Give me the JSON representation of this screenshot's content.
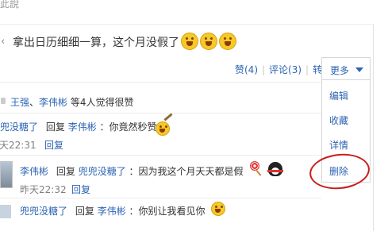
{
  "page": {
    "top_fragment": "此說"
  },
  "post": {
    "caret": "‹",
    "text": "拿出日历细细一算，这个月没假了",
    "emoji_icons": [
      "grinning-face-icon",
      "grinning-face-icon",
      "grinning-face-icon"
    ]
  },
  "actions": {
    "like": "赞(4)",
    "comment": "评论(3)",
    "forward": "转发",
    "more": "更多"
  },
  "more_menu": {
    "items": [
      "编辑",
      "收藏",
      "详情",
      "删除"
    ],
    "highlighted": "删除"
  },
  "likes": {
    "names": [
      "王强",
      "李伟彬"
    ],
    "suffix": "等4人觉得很赞"
  },
  "comments": [
    {
      "author": "兜兜没糖了",
      "reply_word": "回复",
      "reply_to": "李伟彬",
      "text": "：你竟然秒赞",
      "time": "天22:31",
      "reply_label": "回复"
    },
    {
      "author": "李伟彬",
      "reply_word": "回复",
      "reply_to": "兜兜没糖了",
      "text": "：因为我这个月天天都是假",
      "time": "昨天22:32",
      "reply_label": "回复"
    },
    {
      "author": "兜兜没糖了",
      "reply_word": "回复",
      "reply_to": "李伟彬",
      "text": "：你别让我看见你",
      "time": "",
      "reply_label": ""
    }
  ],
  "colors": {
    "link": "#2d64b3",
    "text": "#333333",
    "muted": "#808080",
    "highlight_circle": "#c81e1e"
  }
}
